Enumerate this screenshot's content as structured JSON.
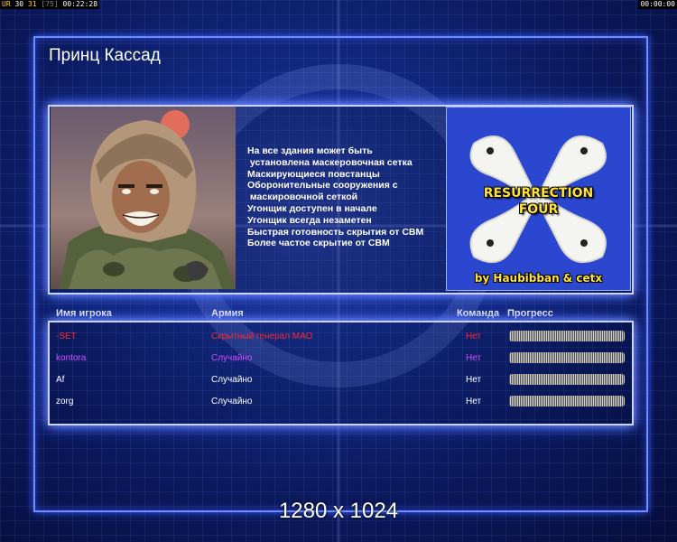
{
  "hud": {
    "left": {
      "a": "UR",
      "b": "30",
      "c": "31",
      "d": "[75]",
      "time": "00:22:28"
    },
    "right": "00:00:00"
  },
  "title": "Принц Кассад",
  "features": [
    "На все здания может быть",
    " установлена маскеровочная сетка",
    "Маскирующиеся повстанцы",
    "Оборонительные сооружения с",
    " маскировочной сеткой",
    "Угонщик доступен в начале",
    "Угонщик всегда незаметен",
    "Быстрая готовность скрытия от СВМ",
    "Более частое скрытие от СВМ"
  ],
  "map": {
    "title_line1": "RESURRECTION",
    "title_line2": "FOUR",
    "credit": "by Haubibban & cetx"
  },
  "columns": {
    "player": "Имя игрока",
    "army": "Армия",
    "team": "Команда",
    "progress": "Прогресс"
  },
  "players": [
    {
      "name": "-SET",
      "army": "Скрытный генерал МАО",
      "team": "Нет",
      "color": "#ff2a2a",
      "progress": 1.0
    },
    {
      "name": "kontora",
      "army": "Случайно",
      "team": "Нет",
      "color": "#d24dff",
      "progress": 1.0
    },
    {
      "name": "Af",
      "army": "Случайно",
      "team": "Нет",
      "color": "#ffffff",
      "progress": 1.0
    },
    {
      "name": "zorg",
      "army": "Случайно",
      "team": "Нет",
      "color": "#ffffff",
      "progress": 1.0
    }
  ],
  "resolution": "1280 x 1024",
  "colors": {
    "frame": "#6f8cff",
    "panel_border": "#c8d4ff",
    "map_text": "#ffe23d"
  }
}
